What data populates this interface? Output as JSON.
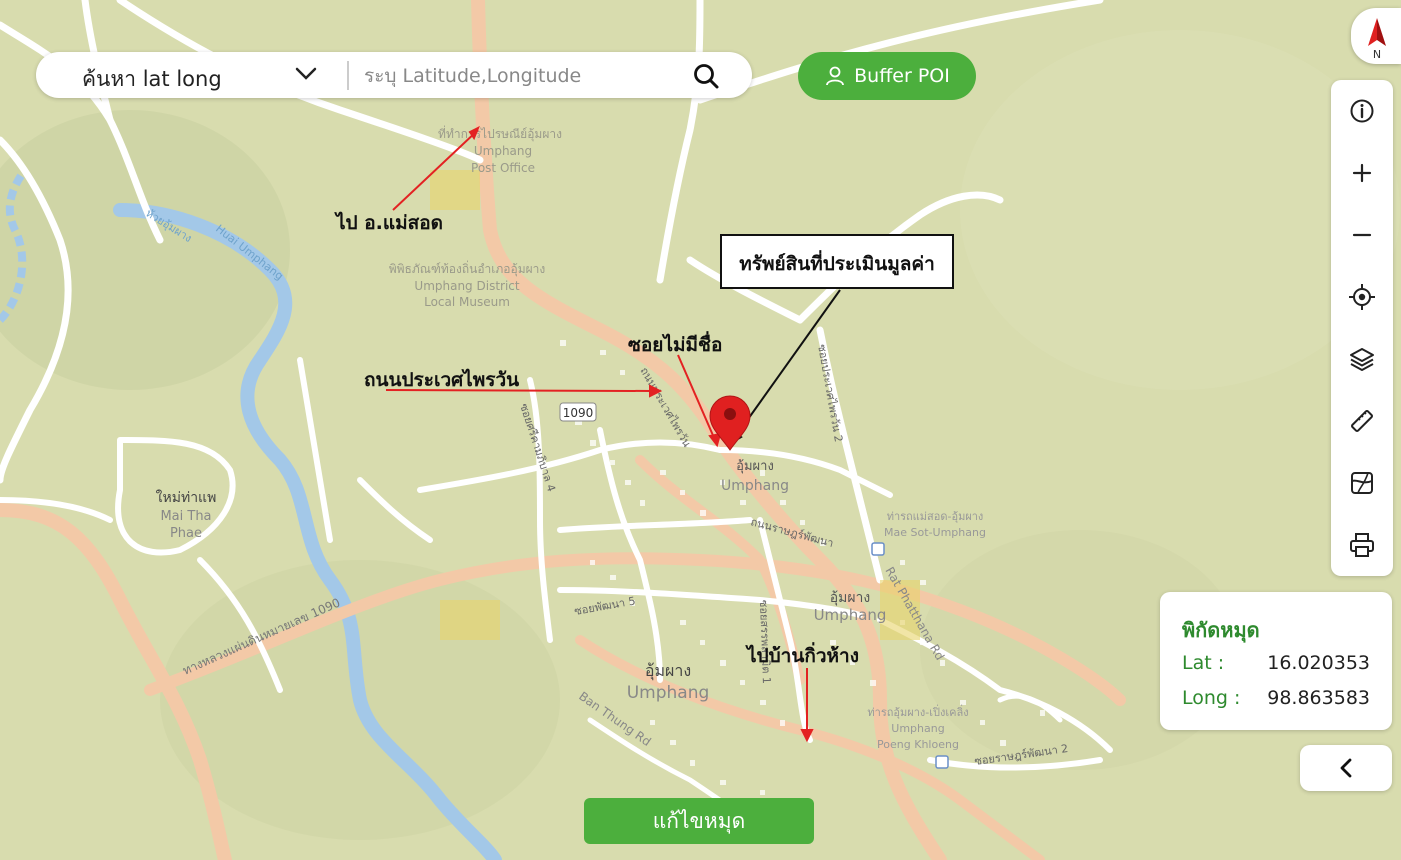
{
  "search": {
    "mode_label": "ค้นหา lat long",
    "placeholder": "ระบุ Latitude,Longitude"
  },
  "buffer_button": {
    "label": "Buffer POI"
  },
  "compass": {
    "north_label": "N"
  },
  "toolbar": {
    "tools": [
      "info-icon",
      "zoom-in-icon",
      "zoom-out-icon",
      "locate-icon",
      "layers-icon",
      "ruler-icon",
      "map-style-icon",
      "print-icon"
    ]
  },
  "coordinates": {
    "title": "พิกัดหมุด",
    "lat_label": "Lat :",
    "lat_value": "16.020353",
    "long_label": "Long :",
    "long_value": "98.863583"
  },
  "edit_button": {
    "label": "แก้ไขหมุด"
  },
  "annotations": {
    "to_maesot": "ไป อ.แม่สอด",
    "property_box": "ทรัพย์สินที่ประเมินมูลค่า",
    "unnamed_soi": "ซอยไม่มีชื่อ",
    "prawet_road": "ถนนประเวศไพรวัน",
    "to_kiewhang": "ไปบ้านกิ่วห้าง"
  },
  "map_labels": {
    "post_office_th": "ที่ทำการไปรษณีย์อุ้มผาง",
    "post_office_en1": "Umphang",
    "post_office_en2": "Post Office",
    "museum_th": "พิพิธภัณฑ์ท้องถิ่นอำเภออุ้มผาง",
    "museum_en1": "Umphang District",
    "museum_en2": "Local Museum",
    "stream_th": "ห้วยอุ้มผาง",
    "stream_en": "Huai Umphang",
    "route_badge": "1090",
    "umphang_th_1": "อุ้มผาง",
    "umphang_en_1": "Umphang",
    "umphang_th_2": "อุ้มผาง",
    "umphang_en_2": "Umphang",
    "umphang_th_3": "อุ้มผาง",
    "umphang_en_3": "Umphang",
    "maitha_th": "ใหม่ท่าแพ",
    "maitha_en1": "Mai Tha",
    "maitha_en2": "Phae",
    "soi4": "ซอยศรีคามภิบาล 4",
    "soi5": "ซอยพัฒนา 5",
    "rajbumrung": "ถนนราษฎร์บำรุง 2",
    "highway": "ทางหลวงแผ่นดินหมายเลข 1090",
    "rat_phatthana": "ถนนราษฎร์พัฒนา",
    "rat_phatthana_en": "Rat Phatthana Rd",
    "bus_maesot_th": "ท่ารถแม่สอด-อุ้มผาง",
    "bus_maesot_en": "Mae Sot-Umphang",
    "bus_poeng_th": "ท่ารถอุ้มผาง-เปิ่งเคลิ่ง",
    "bus_poeng_en1": "Umphang",
    "bus_poeng_en2": "Poeng Khloeng",
    "soi_prawet2": "ซอยประเวศไพรวัน 2",
    "ban_thung": "Ban Thung Rd",
    "soi_ratphatthana2": "ซอยราษฎร์พัฒนา 2",
    "prawet_vertical": "ถนนประเวศไพรวัน",
    "soi_vertical": "ซอยสรรพสามิต 1"
  },
  "colors": {
    "map_bg": "#d8dcae",
    "road_white": "#ffffff",
    "road_major": "#f3c9a7",
    "river": "#a3c8e8",
    "green_accent": "#4caf3d",
    "pin_red": "#e02020",
    "arrow_red": "#e32222"
  }
}
